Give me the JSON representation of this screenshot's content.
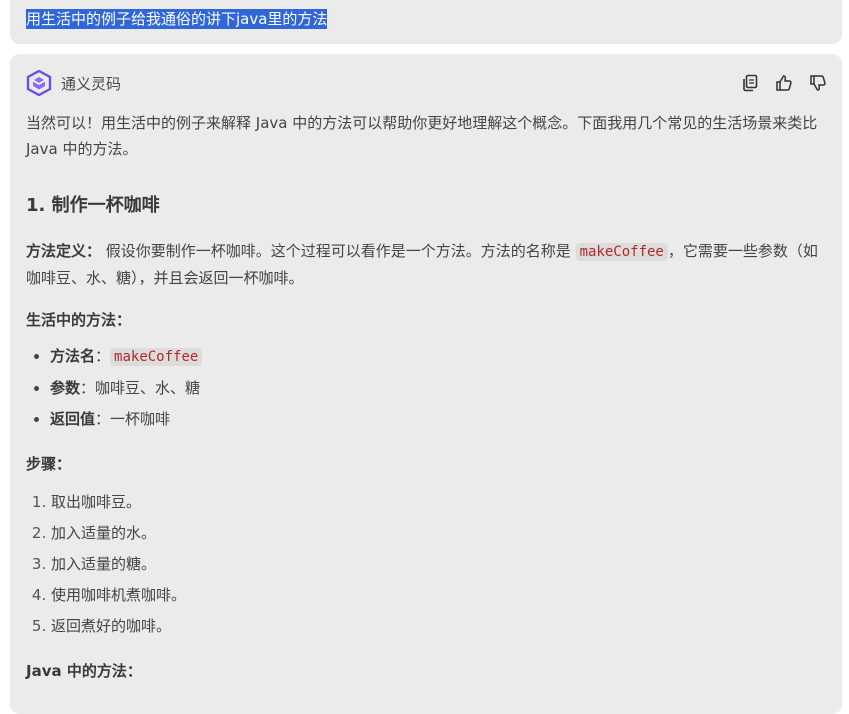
{
  "user_message": "用生活中的例子给我通俗的讲下java里的方法",
  "assistant": {
    "name": "通义灵码",
    "actions": {
      "copy": "copy-icon",
      "like": "thumbs-up-icon",
      "dislike": "thumbs-down-icon"
    }
  },
  "content": {
    "intro": "当然可以！用生活中的例子来解释 Java 中的方法可以帮助你更好地理解这个概念。下面我用几个常见的生活场景来类比 Java 中的方法。",
    "section1_title": "1. 制作一杯咖啡",
    "definition": {
      "label": "方法定义：",
      "text_before": " 假设你要制作一杯咖啡。这个过程可以看作是一个方法。方法的名称是 ",
      "code": "makeCoffee",
      "text_after": "，它需要一些参数（如咖啡豆、水、糖），并且会返回一杯咖啡。"
    },
    "life_method_label": "生活中的方法：",
    "bullets": [
      {
        "label": "方法名",
        "sep": "：",
        "code": "makeCoffee",
        "text": ""
      },
      {
        "label": "参数",
        "sep": "：",
        "code": "",
        "text": "咖啡豆、水、糖"
      },
      {
        "label": "返回值",
        "sep": "：",
        "code": "",
        "text": "一杯咖啡"
      }
    ],
    "steps_label": "步骤：",
    "steps": [
      "取出咖啡豆。",
      "加入适量的水。",
      "加入适量的糖。",
      "使用咖啡机煮咖啡。",
      "返回煮好的咖啡。"
    ],
    "java_method_label": "Java 中的方法："
  },
  "colors": {
    "selection": "#2f66d8",
    "logo": "#6b4fe0",
    "code_text": "#b02a2a"
  }
}
